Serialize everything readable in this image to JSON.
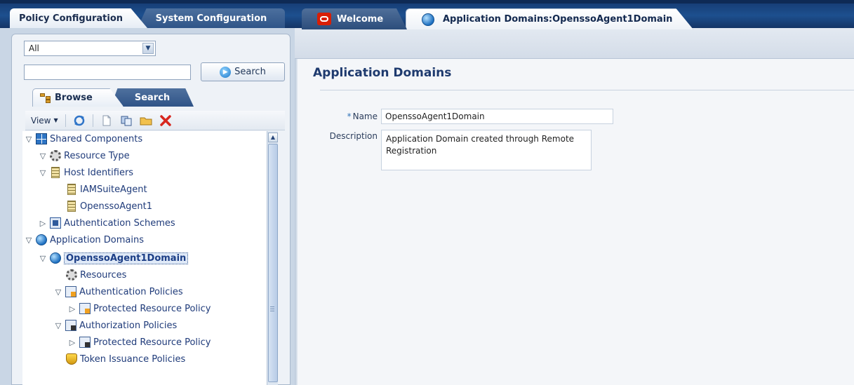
{
  "top_tabs": {
    "policy": "Policy Configuration",
    "system": "System Configuration"
  },
  "navigator": {
    "scope_select": "All",
    "search_value": "",
    "search_button": "Search",
    "tabs": {
      "browse": "Browse",
      "search": "Search"
    },
    "toolbar": {
      "view_label": "View"
    },
    "tree": [
      {
        "label": "Shared Components",
        "icon": "grid-icon",
        "state": "expanded",
        "level": 0
      },
      {
        "label": "Resource Type",
        "icon": "gear-icon",
        "state": "expanded",
        "level": 1
      },
      {
        "label": "Host Identifiers",
        "icon": "document-icon",
        "state": "expanded",
        "level": 1
      },
      {
        "label": "IAMSuiteAgent",
        "icon": "document-icon",
        "state": "leaf",
        "level": 2
      },
      {
        "label": "OpenssoAgent1",
        "icon": "document-icon",
        "state": "leaf",
        "level": 2
      },
      {
        "label": "Authentication Schemes",
        "icon": "auth-scheme-icon",
        "state": "collapsed",
        "level": 1
      },
      {
        "label": "Application Domains",
        "icon": "globe-icon",
        "state": "expanded",
        "level": 0
      },
      {
        "label": "OpenssoAgent1Domain",
        "icon": "globe-icon",
        "state": "expanded",
        "level": 1,
        "selected": true
      },
      {
        "label": "Resources",
        "icon": "gear-icon",
        "state": "leaf",
        "level": 2
      },
      {
        "label": "Authentication Policies",
        "icon": "authn-policy-icon",
        "state": "expanded",
        "level": 2
      },
      {
        "label": "Protected Resource Policy",
        "icon": "authn-policy-icon",
        "state": "collapsed",
        "level": 3
      },
      {
        "label": "Authorization Policies",
        "icon": "authz-policy-icon",
        "state": "expanded",
        "level": 2
      },
      {
        "label": "Protected Resource Policy",
        "icon": "authz-policy-icon",
        "state": "collapsed",
        "level": 3
      },
      {
        "label": "Token Issuance Policies",
        "icon": "shield-icon",
        "state": "leaf",
        "level": 2
      }
    ]
  },
  "content_tabs": {
    "welcome": "Welcome",
    "active": "Application Domains:OpenssoAgent1Domain"
  },
  "page": {
    "title": "Application Domains",
    "name_label": "Name",
    "required_marker": "*",
    "name_value": "OpenssoAgent1Domain",
    "description_label": "Description",
    "description_value": "Application Domain created through Remote Registration"
  },
  "colors": {
    "header_blue": "#1d4f8e",
    "oracle_red": "#d81e05",
    "tree_link": "#1f3b7a"
  }
}
